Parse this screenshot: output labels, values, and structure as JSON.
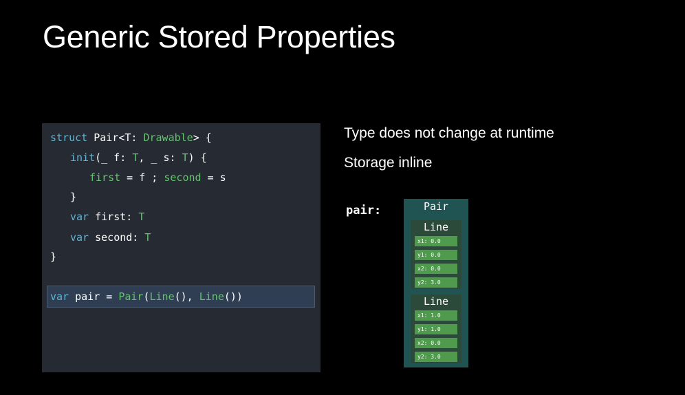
{
  "slide": {
    "title": "Generic Stored Properties"
  },
  "code": {
    "lines": [
      [
        {
          "t": "struct ",
          "c": "kw"
        },
        {
          "t": "Pair<T: ",
          "c": "pl"
        },
        {
          "t": "Drawable",
          "c": "ty"
        },
        {
          "t": "> {",
          "c": "pl"
        }
      ],
      [
        {
          "t": "init",
          "c": "kw"
        },
        {
          "t": "(_ ",
          "c": "pl"
        },
        {
          "t": "f: ",
          "c": "pl"
        },
        {
          "t": "T",
          "c": "ty"
        },
        {
          "t": ", _ s: ",
          "c": "pl"
        },
        {
          "t": "T",
          "c": "ty"
        },
        {
          "t": ") {",
          "c": "pl"
        }
      ],
      [
        {
          "t": "first",
          "c": "ty"
        },
        {
          "t": " = f ; ",
          "c": "pl"
        },
        {
          "t": "second",
          "c": "ty"
        },
        {
          "t": " = s",
          "c": "pl"
        }
      ],
      [
        {
          "t": "}",
          "c": "pl"
        }
      ],
      [
        {
          "t": "var ",
          "c": "kw"
        },
        {
          "t": "first: ",
          "c": "pl"
        },
        {
          "t": "T",
          "c": "ty"
        }
      ],
      [
        {
          "t": "var ",
          "c": "kw"
        },
        {
          "t": "second: ",
          "c": "pl"
        },
        {
          "t": "T",
          "c": "ty"
        }
      ],
      [
        {
          "t": "}",
          "c": "pl"
        }
      ]
    ],
    "highlighted_line": [
      {
        "t": "var ",
        "c": "kw"
      },
      {
        "t": "pair = ",
        "c": "pl"
      },
      {
        "t": "Pair",
        "c": "ty"
      },
      {
        "t": "(",
        "c": "pl"
      },
      {
        "t": "Line",
        "c": "ty"
      },
      {
        "t": "(), ",
        "c": "pl"
      },
      {
        "t": "Line",
        "c": "ty"
      },
      {
        "t": "())",
        "c": "pl"
      }
    ]
  },
  "bullets": [
    "Type does not change at runtime",
    "Storage inline"
  ],
  "memory": {
    "var_label": "pair:",
    "pair_title": "Pair",
    "lines": [
      {
        "title": "Line",
        "fields": [
          "x1: 0.0",
          "y1: 0.0",
          "x2: 0.0",
          "y2: 3.0"
        ]
      },
      {
        "title": "Line",
        "fields": [
          "x1: 1.0",
          "y1: 1.0",
          "x2: 0.0",
          "y2: 3.0"
        ]
      }
    ]
  },
  "colors": {
    "keyword": "#5fb6d6",
    "type": "#64c46e",
    "code_background": "#262a32",
    "pair_box": "#1f5452",
    "line_box": "#2c4a3a",
    "field": "#4f9a4d"
  }
}
